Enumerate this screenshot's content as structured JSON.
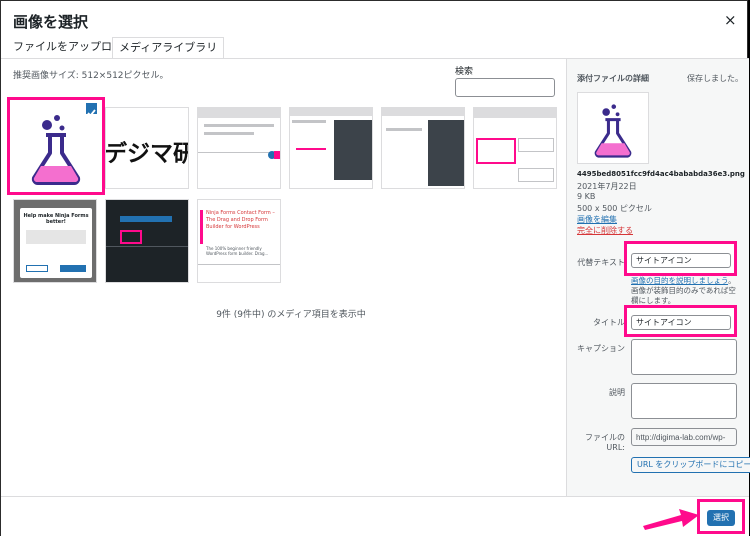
{
  "dialog": {
    "title": "画像を選択",
    "close_glyph": "×"
  },
  "tabs": [
    {
      "label": "ファイルをアップロード",
      "active": false
    },
    {
      "label": "メディアライブラリ",
      "active": true
    }
  ],
  "hint": "推奨画像サイズ: 512×512ピクセル。",
  "search": {
    "label": "検索",
    "value": ""
  },
  "grid": {
    "thumb2_text": "デジマ研究",
    "item7_text": "Help make Ninja Forms better!",
    "item9_text": "Ninja Forms Contact Form – The Drag and Drop Form Builder for WordPress",
    "item9_sub": "The 100% beginner friendly WordPress form builder. Drag..."
  },
  "count_text": "9件 (9件中) のメディア項目を表示中",
  "details": {
    "heading": "添付ファイルの詳細",
    "saved": "保存しました。",
    "filename": "4495bed8051fcc9fd4ac4babab​da36e3.png",
    "date": "2021年7月22日",
    "size": "9 KB",
    "dimensions": "500 x 500 ピクセル",
    "edit_link": "画像を編集",
    "delete_link": "完全に削除する",
    "alt_label": "代替テキスト",
    "alt_value": "サイトアイコン",
    "alt_help_link": "画像の目的を説明しましょう",
    "alt_help_text": "。画像が装飾目的のみであれば空欄にします。",
    "title_label": "タイトル",
    "title_value": "サイトアイコン",
    "caption_label": "キャプション",
    "desc_label": "説明",
    "url_label": "ファイルのURL:",
    "url_value": "http://digima-lab.com/wp-",
    "copy_button": "URL をクリップボードにコピー"
  },
  "footer": {
    "select_button": "選択"
  },
  "colors": {
    "accent": "#2271b1",
    "highlight": "#ff0a8c",
    "delete": "#d63638"
  }
}
